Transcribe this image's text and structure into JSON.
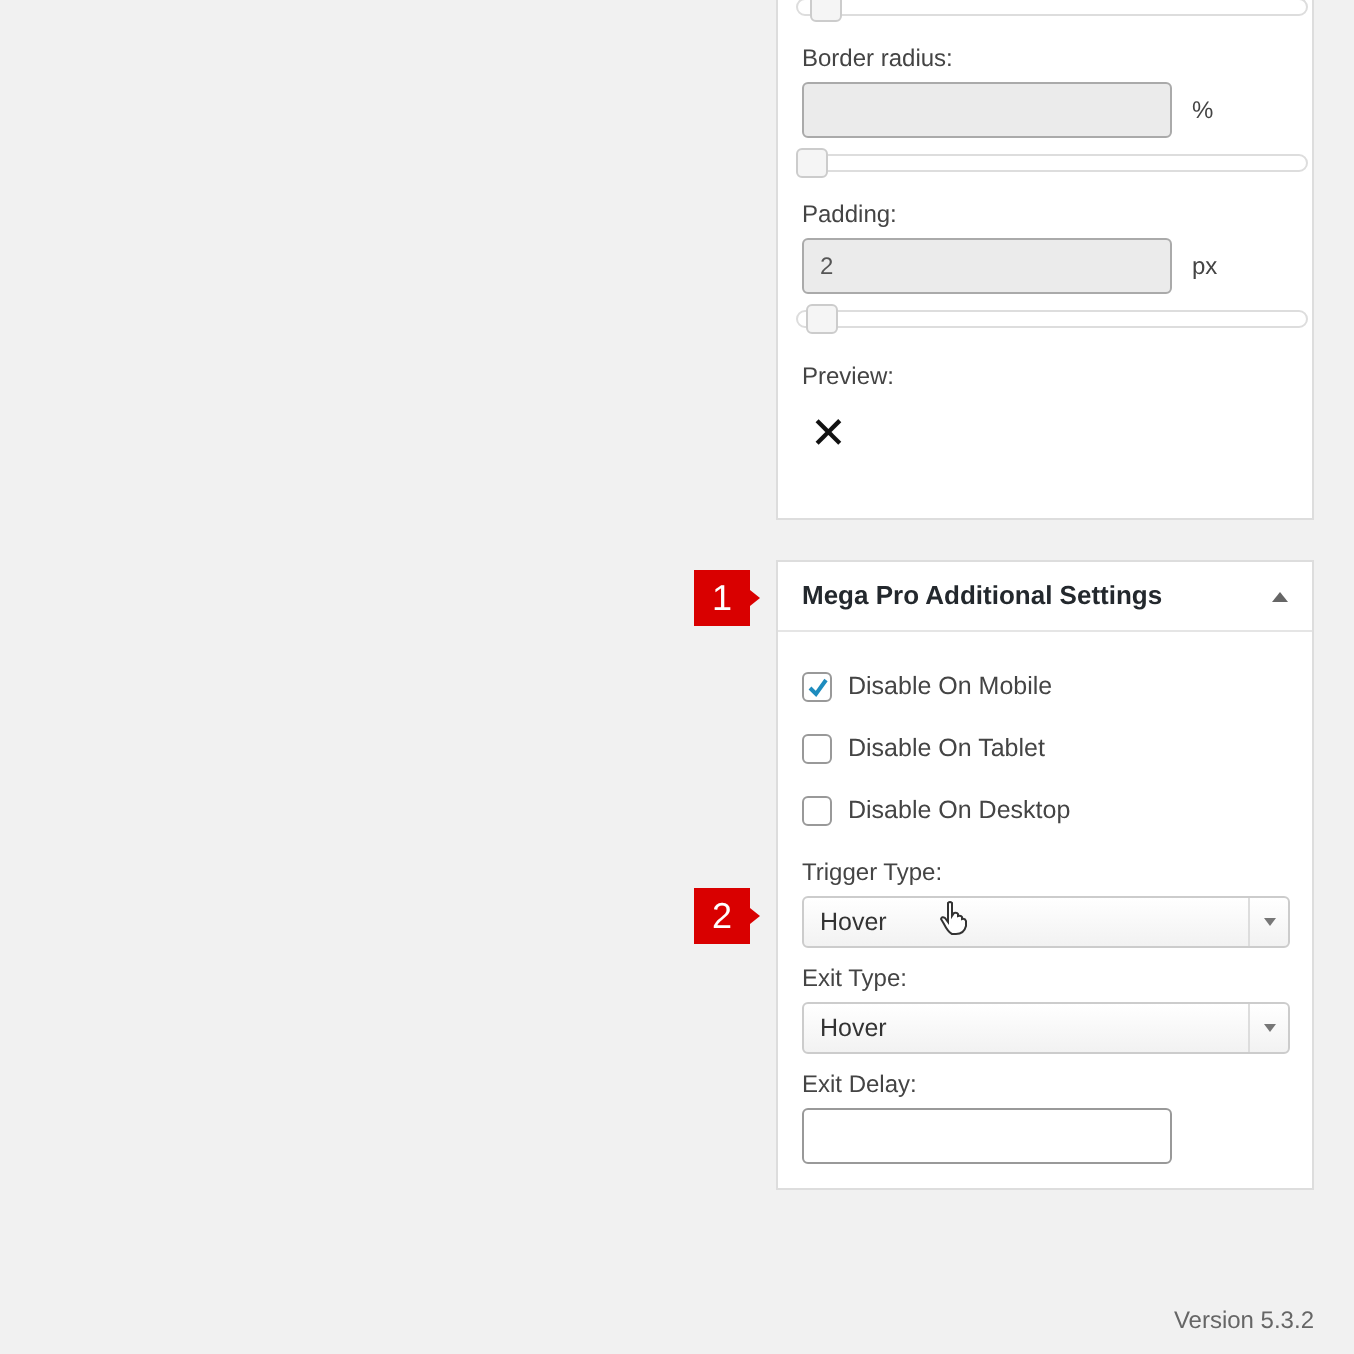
{
  "style_panel": {
    "top_slider": {
      "level": 0.03
    },
    "fields": [
      {
        "label": "Border radius:",
        "unit": "%",
        "disabled": true,
        "level": 0.0
      },
      {
        "label": "Padding:",
        "value": "2",
        "unit": "px",
        "disabled": true,
        "level": 0.02
      }
    ],
    "preview_label": "Preview:",
    "preview_glyph": "✕"
  },
  "settings_panel": {
    "callout": "1",
    "title": "Mega Pro Additional Settings",
    "expanded": true,
    "checkboxes": [
      {
        "label": "Disable On Mobile",
        "checked": true
      },
      {
        "label": "Disable On Tablet",
        "checked": false
      },
      {
        "label": "Disable On Desktop",
        "checked": false
      }
    ],
    "selects": [
      {
        "label": "Trigger Type:",
        "value": "Hover",
        "callout": "2"
      },
      {
        "label": "Exit Type:",
        "value": "Hover"
      }
    ],
    "delay": {
      "label": "Exit Delay:"
    }
  },
  "version": "Version 5.3.2"
}
